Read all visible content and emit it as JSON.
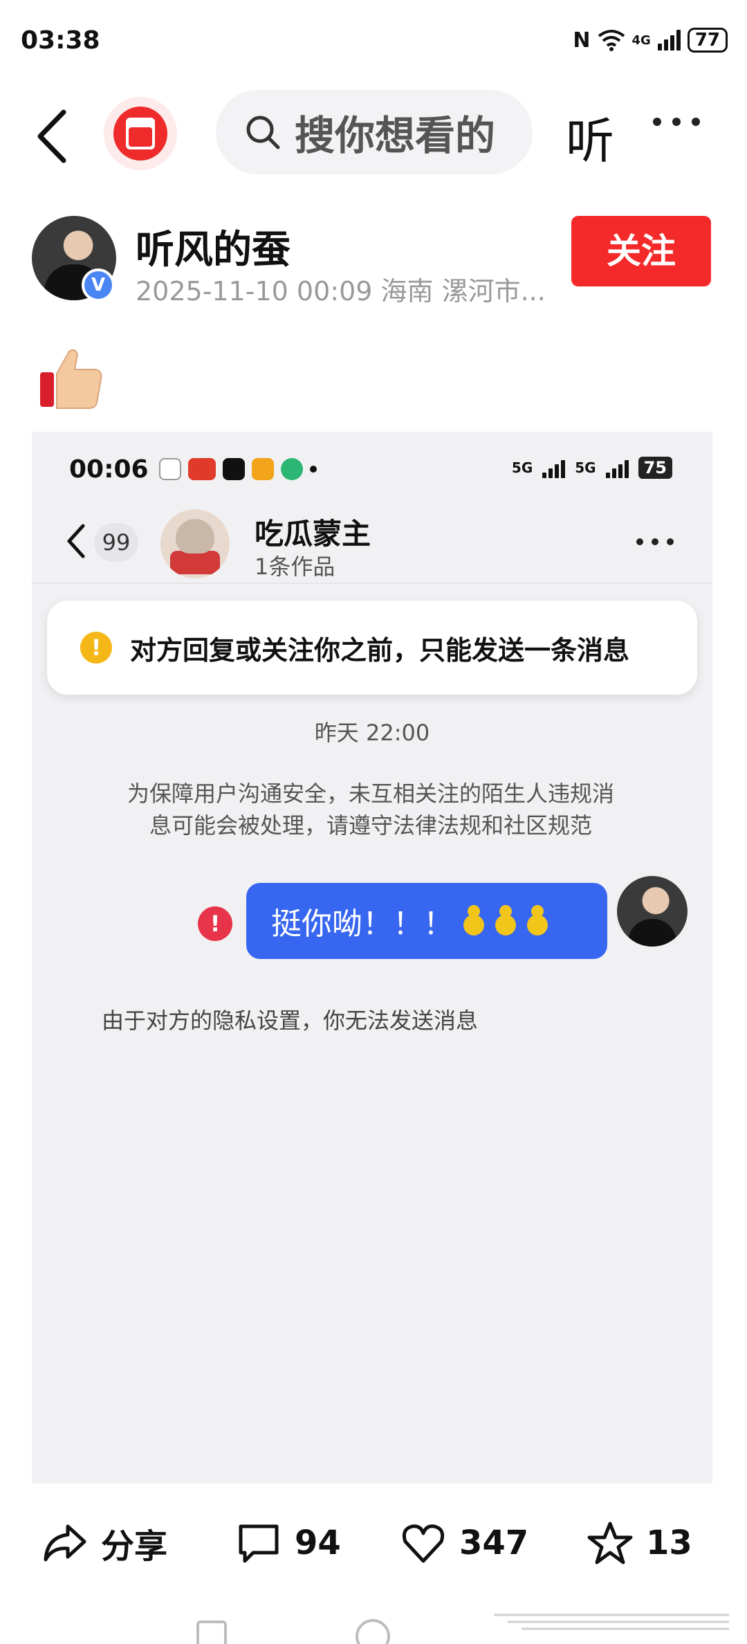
{
  "status_bar": {
    "time": "03:38",
    "nfc": "N",
    "network": "4G",
    "battery": "77"
  },
  "top_bar": {
    "search_placeholder": "搜你想看的",
    "listen_label": "听"
  },
  "author": {
    "name": "听风的蚕",
    "verified_badge": "V",
    "meta": "2025-11-10 00:09 海南 漯河市...",
    "follow_label": "关注"
  },
  "embed": {
    "status": {
      "time": "00:06",
      "network_a": "5G",
      "network_b": "5G",
      "battery": "75"
    },
    "header": {
      "unread_count": "99",
      "contact_name": "吃瓜蒙主",
      "works_count": "1条作品"
    },
    "notice": {
      "icon": "!",
      "text": "对方回复或关注你之前，只能发送一条消息"
    },
    "timestamp": "昨天 22:00",
    "safety_notice": "为保障用户沟通安全，未互相关注的陌生人违规消息可能会被处理，请遵守法律法规和社区规范",
    "message": {
      "error_icon": "!",
      "text": "挺你呦！！！"
    },
    "privacy_notice": "由于对方的隐私设置，你无法发送消息"
  },
  "actions": {
    "share_label": "分享",
    "comments_count": "94",
    "likes_count": "347",
    "favorites_count": "13"
  },
  "colors": {
    "follow_red": "#f42a2a",
    "bubble_blue": "#3766f0",
    "notice_yellow": "#f5b717",
    "error_red": "#e8344a"
  }
}
